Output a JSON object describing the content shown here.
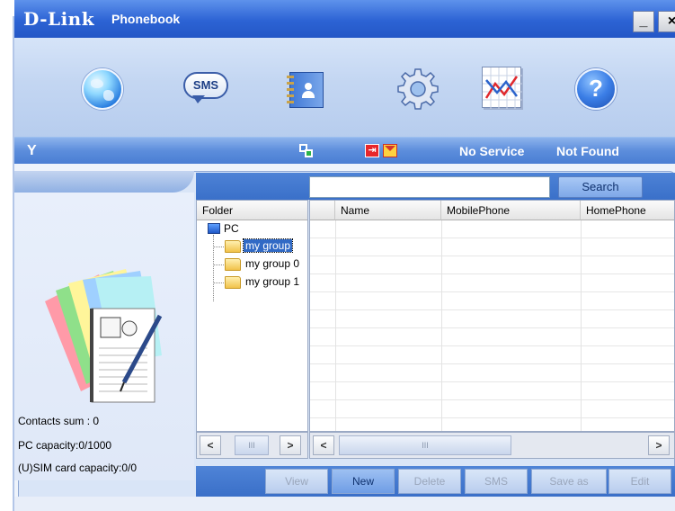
{
  "title": {
    "brand": "D-Link",
    "app": "Phonebook"
  },
  "window": {
    "minimize": "_",
    "close": "×"
  },
  "toolbar": {
    "items": [
      {
        "name": "internet",
        "icon": "globe-icon"
      },
      {
        "name": "sms",
        "icon": "sms-icon",
        "label": "SMS"
      },
      {
        "name": "phonebook",
        "icon": "phonebook-icon"
      },
      {
        "name": "settings",
        "icon": "gear-icon"
      },
      {
        "name": "statistics",
        "icon": "chart-icon"
      },
      {
        "name": "help",
        "icon": "help-icon",
        "label": "?"
      }
    ]
  },
  "status": {
    "signal_icon": "antenna-icon",
    "antenna": "Y",
    "inbox_icon": "message-in-icon",
    "inbox_glyph": "⇥",
    "service": "No Service",
    "device": "Not Found"
  },
  "search": {
    "value": "",
    "button": "Search"
  },
  "tree": {
    "header": "Folder",
    "root": "PC",
    "folders": [
      "my group",
      "my group 0",
      "my group 1"
    ],
    "selected": "my group"
  },
  "table": {
    "columns": [
      "",
      "Name",
      "MobilePhone",
      "HomePhone"
    ],
    "rows": []
  },
  "info": {
    "contacts_sum": "Contacts sum : 0",
    "pc_capacity": "PC capacity:0/1000",
    "sim_capacity": "(U)SIM card capacity:0/0"
  },
  "scroll": {
    "left": "<",
    "right": ">",
    "thumb": "III"
  },
  "actions": {
    "view": "View",
    "new": "New",
    "delete": "Delete",
    "sms": "SMS",
    "save_as": "Save as",
    "edit": "Edit"
  },
  "colors": {
    "title_bar": "#2c63d4",
    "toolbar": "#c3d6f2",
    "status_bar": "#5c8ddc",
    "selection": "#316ac5"
  }
}
